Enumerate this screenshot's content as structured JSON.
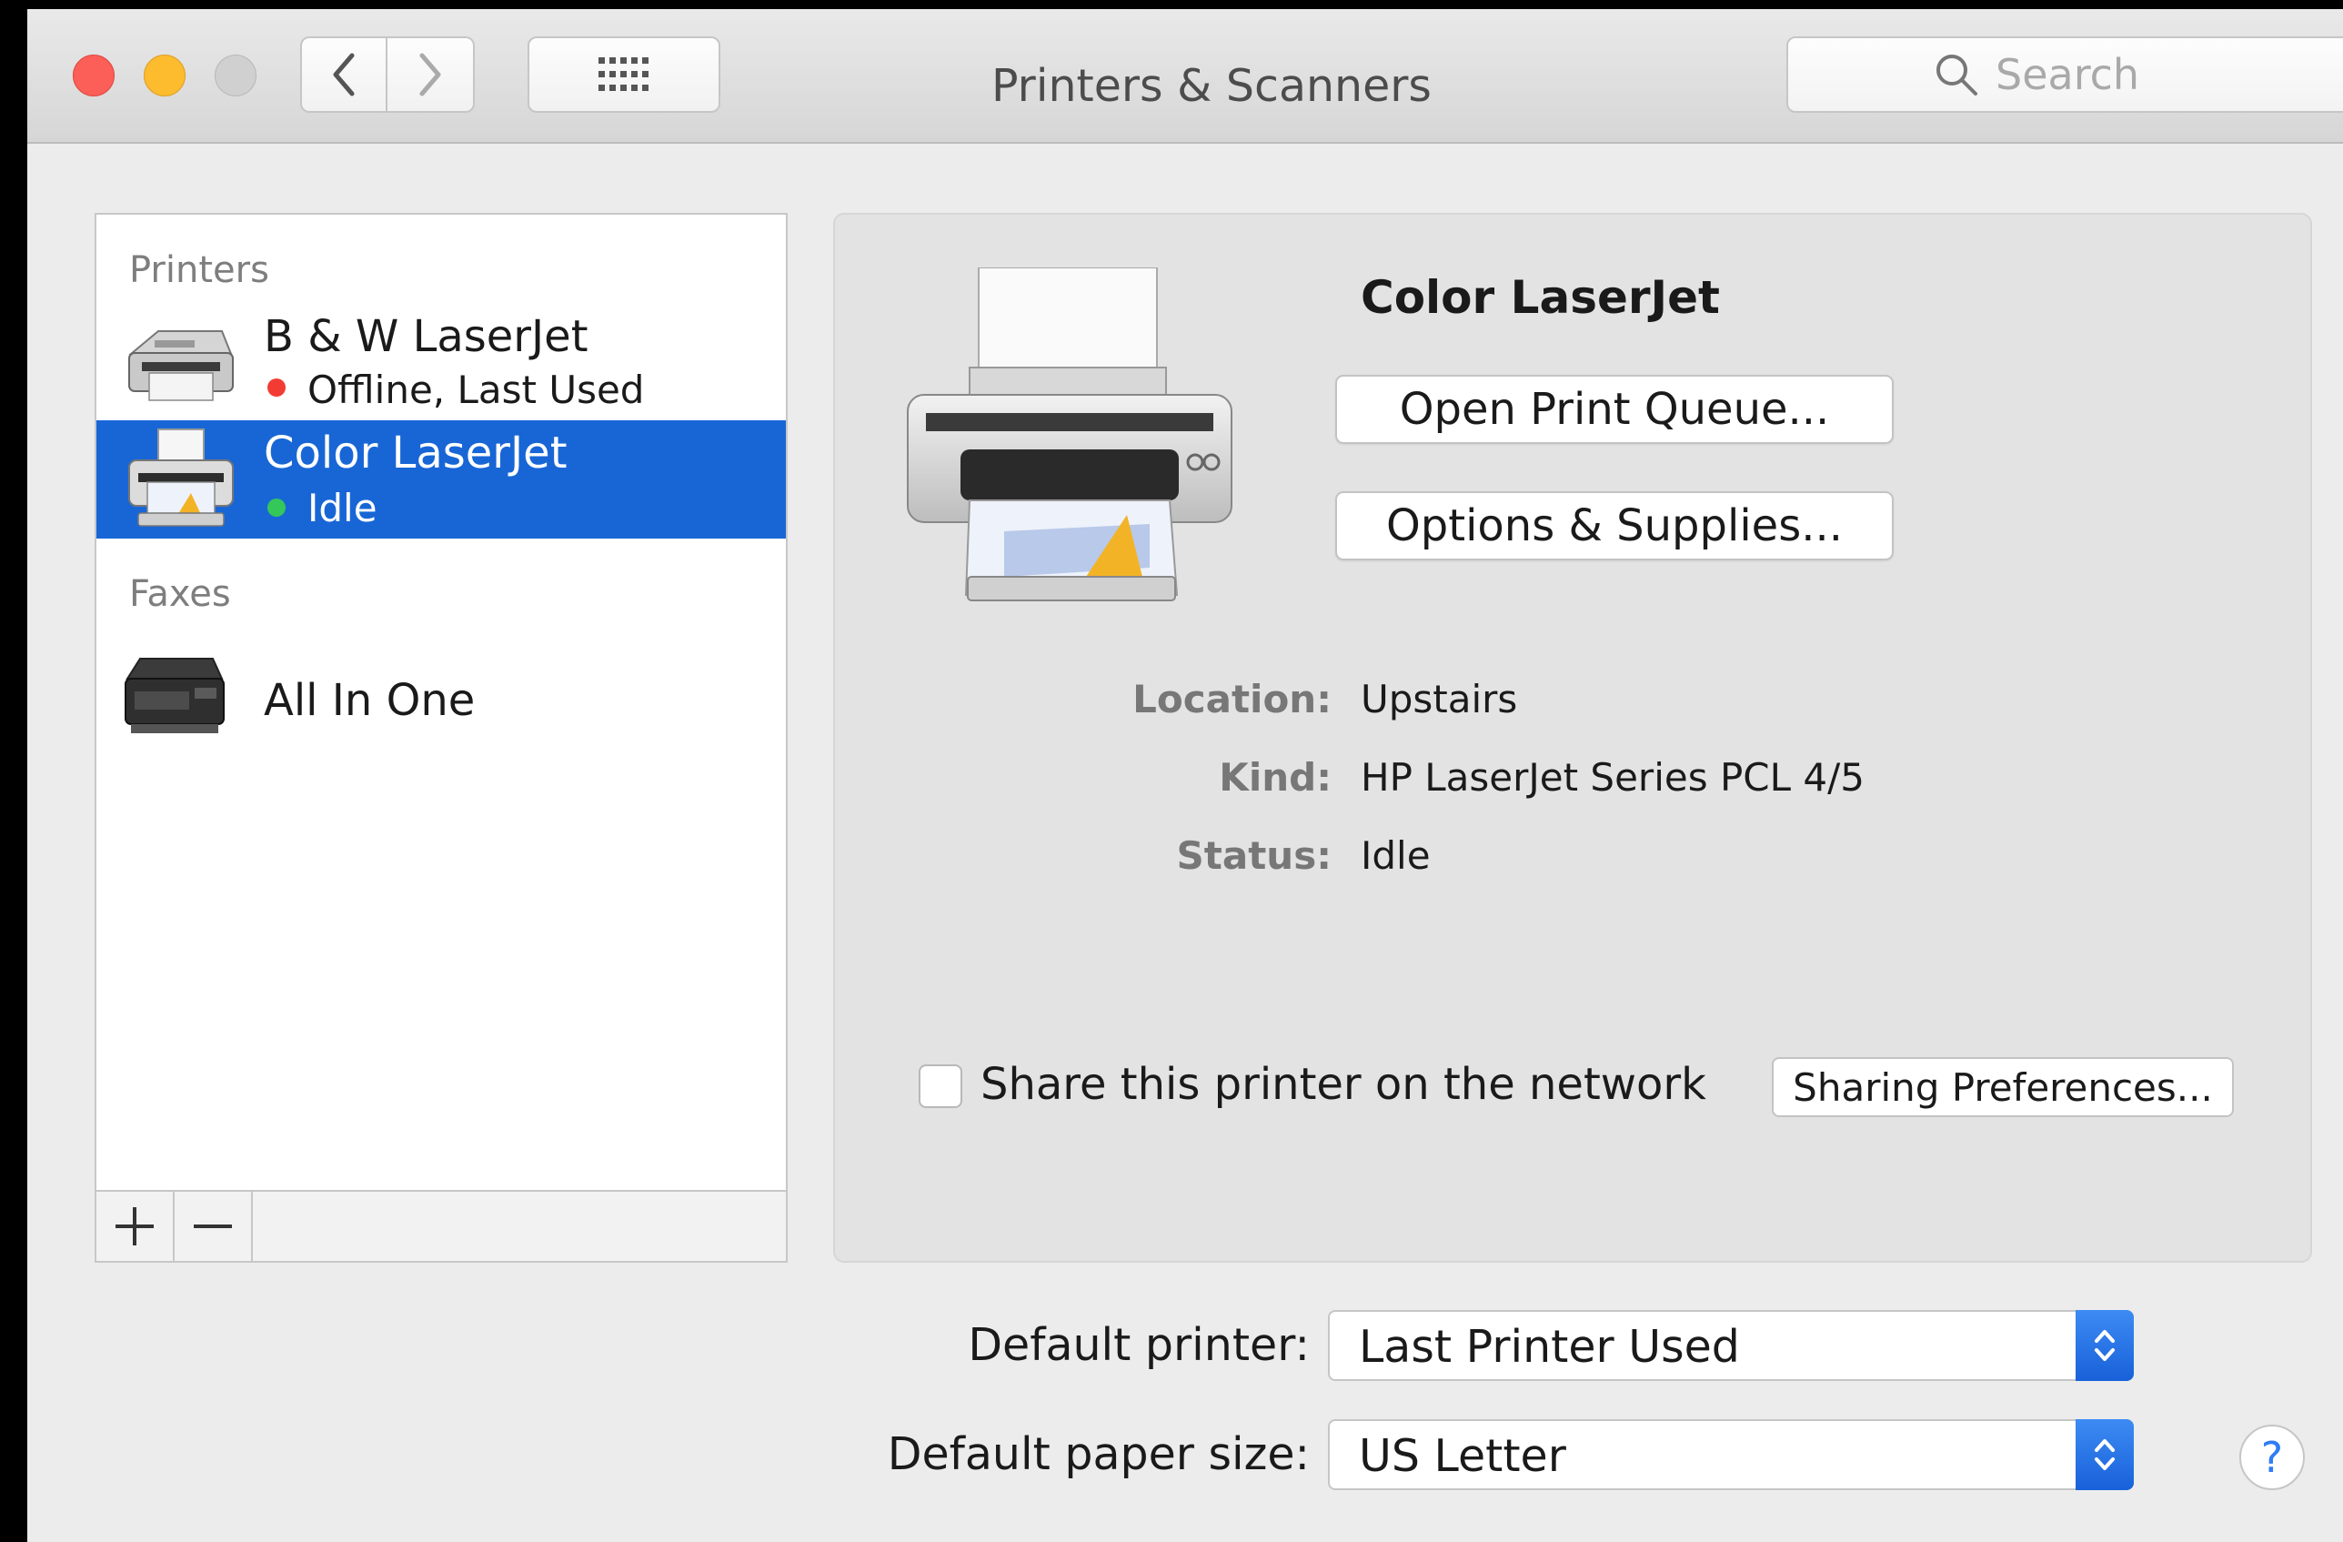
{
  "window": {
    "title": "Printers & Scanners"
  },
  "toolbar": {
    "back_icon": "chevron-left",
    "forward_icon": "chevron-right",
    "grid_icon": "show-all-grid",
    "search_placeholder": "Search"
  },
  "sidebar": {
    "printers_heading": "Printers",
    "faxes_heading": "Faxes",
    "printers": [
      {
        "name": "B & W LaserJet",
        "status": "Offline, Last Used",
        "status_color": "#f23c33",
        "selected": false
      },
      {
        "name": "Color LaserJet",
        "status": "Idle",
        "status_color": "#34c759",
        "selected": true
      }
    ],
    "faxes": [
      {
        "name": "All In One"
      }
    ],
    "add_icon": "plus",
    "remove_icon": "minus"
  },
  "detail": {
    "printer_name": "Color LaserJet",
    "open_queue_label": "Open Print Queue...",
    "options_label": "Options & Supplies...",
    "location_label": "Location:",
    "location_value": "Upstairs",
    "kind_label": "Kind:",
    "kind_value": "HP LaserJet Series PCL 4/5",
    "status_label": "Status:",
    "status_value": "Idle",
    "share_label": "Share this printer on the network",
    "share_checked": false,
    "sharing_prefs_label": "Sharing Preferences..."
  },
  "defaults": {
    "default_printer_label": "Default printer:",
    "default_printer_value": "Last Printer Used",
    "paper_size_label": "Default paper size:",
    "paper_size_value": "US Letter"
  },
  "help_label": "?",
  "colors": {
    "selection": "#1866d6",
    "accent": "#2f7cf6"
  }
}
